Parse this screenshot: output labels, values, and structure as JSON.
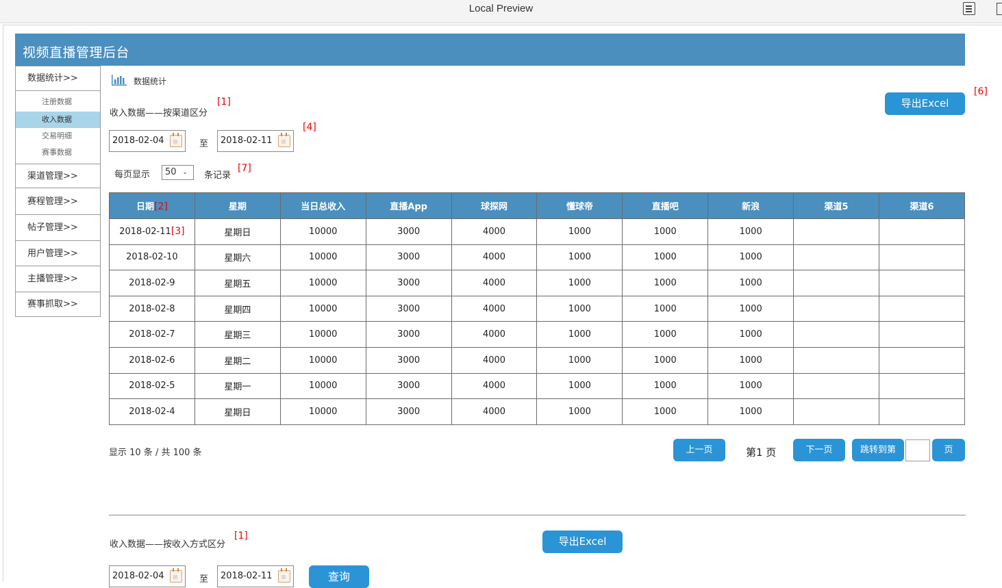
{
  "window": {
    "title": "Local Preview"
  },
  "app": {
    "title": "视频直播管理后台"
  },
  "sidebar": {
    "groups": [
      {
        "label": "数据统计>>"
      },
      {
        "label": "渠道管理>>"
      },
      {
        "label": "赛程管理>>"
      },
      {
        "label": "帖子管理>>"
      },
      {
        "label": "用户管理>>"
      },
      {
        "label": "主播管理>>"
      },
      {
        "label": "赛事抓取>>"
      }
    ],
    "subitems": [
      {
        "label": "注册数据"
      },
      {
        "label": "收入数据",
        "active": true
      },
      {
        "label": "交易明细"
      },
      {
        "label": "赛事数据"
      }
    ]
  },
  "breadcrumb": {
    "label": "数据统计",
    "icon": "bar-chart-icon"
  },
  "section1": {
    "title": "收入数据——按渠道区分",
    "tag_title": "[1]",
    "tag_dates": "[4]",
    "tag_export": "[6]",
    "tag_perpage": "[7]",
    "export_label": "导出Excel",
    "date_from": "2018-02-04",
    "date_to": "2018-02-11",
    "date_sep": "至",
    "per_page_prefix": "每页显示",
    "per_page_value": "50",
    "per_page_suffix": "条记录"
  },
  "table": {
    "headers": [
      "日期",
      "星期",
      "当日总收入",
      "直播App",
      "球探网",
      "懂球帝",
      "直播吧",
      "新浪",
      "渠道5",
      "渠道6"
    ],
    "header_tag": "[2]",
    "cell_tag": "[3]",
    "rows": [
      [
        "2018-02-11",
        "星期日",
        "10000",
        "3000",
        "4000",
        "1000",
        "1000",
        "1000",
        "",
        ""
      ],
      [
        "2018-02-10",
        "星期六",
        "10000",
        "3000",
        "4000",
        "1000",
        "1000",
        "1000",
        "",
        ""
      ],
      [
        "2018-02-9",
        "星期五",
        "10000",
        "3000",
        "4000",
        "1000",
        "1000",
        "1000",
        "",
        ""
      ],
      [
        "2018-02-8",
        "星期四",
        "10000",
        "3000",
        "4000",
        "1000",
        "1000",
        "1000",
        "",
        ""
      ],
      [
        "2018-02-7",
        "星期三",
        "10000",
        "3000",
        "4000",
        "1000",
        "1000",
        "1000",
        "",
        ""
      ],
      [
        "2018-02-6",
        "星期二",
        "10000",
        "3000",
        "4000",
        "1000",
        "1000",
        "1000",
        "",
        ""
      ],
      [
        "2018-02-5",
        "星期一",
        "10000",
        "3000",
        "4000",
        "1000",
        "1000",
        "1000",
        "",
        ""
      ],
      [
        "2018-02-4",
        "星期日",
        "10000",
        "3000",
        "4000",
        "1000",
        "1000",
        "1000",
        "",
        ""
      ]
    ]
  },
  "pager": {
    "info": "显示  10 条  / 共 100 条",
    "prev": "上一页",
    "page": "第1 页",
    "next": "下一页",
    "jump": "跳转到第",
    "page_unit": "页"
  },
  "section2": {
    "title": "收入数据——按收入方式区分",
    "tag_title": "[1]",
    "export_label": "导出Excel",
    "date_from": "2018-02-04",
    "date_to": "2018-02-11",
    "date_sep": "至",
    "query_label": "查询"
  },
  "colors": {
    "header_bg": "#4a8fbe",
    "button_bg": "#2a94d6",
    "active_sub_bg": "#a9d4ea",
    "tag_red": "#e00000"
  }
}
